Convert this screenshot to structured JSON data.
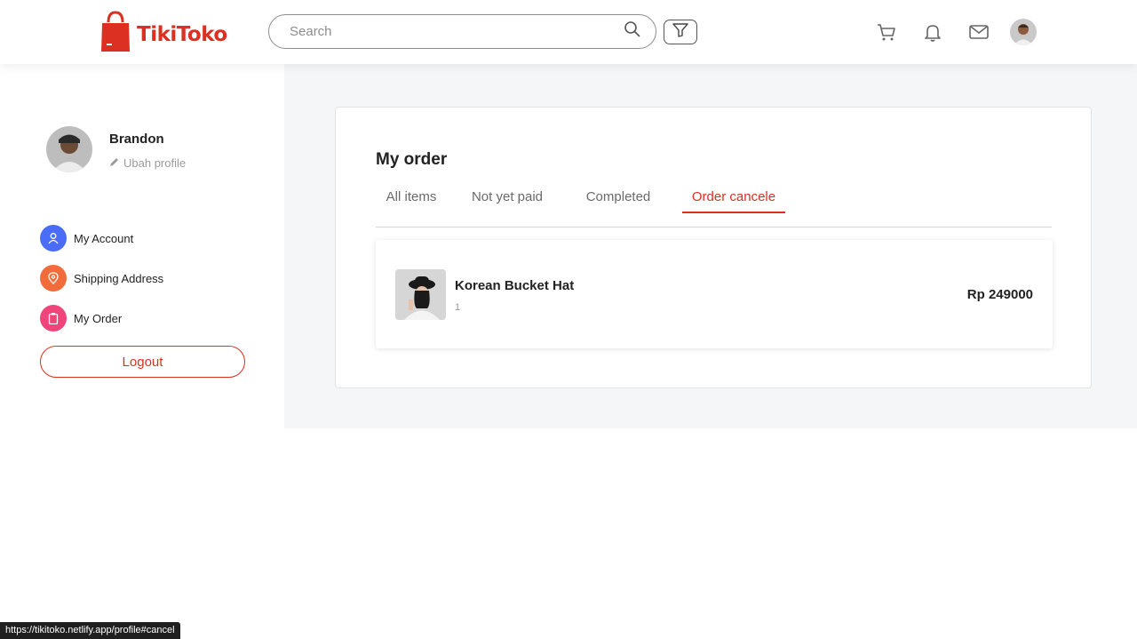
{
  "header": {
    "brand": "TikiToko",
    "search_placeholder": "Search"
  },
  "profile": {
    "name": "Brandon",
    "edit_label": "Ubah profile"
  },
  "sidebar": {
    "items": [
      {
        "label": "My Account",
        "icon": "user-icon",
        "color": "#4a6cf7"
      },
      {
        "label": "Shipping Address",
        "icon": "location-icon",
        "color": "#f26b3a"
      },
      {
        "label": "My Order",
        "icon": "clipboard-icon",
        "color": "#f0457a"
      }
    ],
    "logout_label": "Logout"
  },
  "main": {
    "title": "My order",
    "tabs": [
      {
        "label": "All items",
        "active": false
      },
      {
        "label": "Not yet paid",
        "active": false
      },
      {
        "label": "Completed",
        "active": false
      },
      {
        "label": "Order cancele",
        "active": true
      }
    ],
    "orders": [
      {
        "name": "Korean Bucket Hat",
        "qty": "1",
        "price": "Rp 249000"
      }
    ]
  },
  "status_bar": {
    "url": "https://tikitoko.netlify.app/profile#cancel"
  },
  "colors": {
    "brand": "#db3022",
    "page_bg": "#f5f6f8"
  }
}
